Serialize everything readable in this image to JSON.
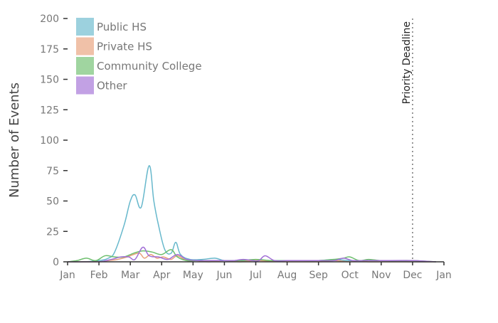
{
  "chart_data": {
    "type": "line",
    "title": "",
    "xlabel": "",
    "ylabel": "Number of Events",
    "ylim": [
      0,
      200
    ],
    "xlim": [
      1,
      13
    ],
    "x_ticks": [
      {
        "value": 1,
        "label": "Jan"
      },
      {
        "value": 2,
        "label": "Feb"
      },
      {
        "value": 3,
        "label": "Mar"
      },
      {
        "value": 4,
        "label": "Apr"
      },
      {
        "value": 5,
        "label": "May"
      },
      {
        "value": 6,
        "label": "Jun"
      },
      {
        "value": 7,
        "label": "Jul"
      },
      {
        "value": 8,
        "label": "Aug"
      },
      {
        "value": 9,
        "label": "Sep"
      },
      {
        "value": 10,
        "label": "Oct"
      },
      {
        "value": 11,
        "label": "Nov"
      },
      {
        "value": 12,
        "label": "Dec"
      },
      {
        "value": 13,
        "label": "Jan"
      }
    ],
    "y_ticks": [
      0,
      25,
      50,
      75,
      100,
      125,
      150,
      175,
      200
    ],
    "grid": false,
    "legend_position": "top-left",
    "x_unit": "month",
    "series": [
      {
        "name": "Public HS",
        "color": "#67B8CC",
        "x": [
          1,
          1.5,
          2.0,
          2.3,
          2.5,
          2.8,
          3.0,
          3.15,
          3.35,
          3.6,
          3.75,
          3.9,
          4.1,
          4.3,
          4.45,
          4.6,
          4.9,
          5.3,
          5.7,
          6.0,
          6.5,
          7.0,
          7.5,
          8.0,
          9.0,
          9.5,
          10.0,
          11.0,
          12.0,
          12.75
        ],
        "y": [
          0,
          0,
          1,
          3,
          8,
          30,
          50,
          55,
          45,
          79,
          50,
          30,
          10,
          7,
          16,
          6,
          2,
          2,
          3,
          1,
          1,
          1,
          1,
          1,
          1,
          2,
          1,
          1,
          0,
          0
        ]
      },
      {
        "name": "Private HS",
        "color": "#E8A07A",
        "x": [
          1,
          1.5,
          2.0,
          2.3,
          2.6,
          2.9,
          3.1,
          3.3,
          3.45,
          3.65,
          3.85,
          4.05,
          4.3,
          4.5,
          4.8,
          5.1,
          5.5,
          6.0,
          6.5,
          7.0,
          8.0,
          9.0,
          9.5,
          10.0,
          10.3,
          10.6,
          11.0,
          12.0,
          12.75
        ],
        "y": [
          0,
          0,
          0,
          1,
          2,
          4,
          6,
          7,
          3,
          6,
          3,
          4,
          2,
          5,
          1,
          1,
          0,
          1,
          0,
          1,
          0,
          0,
          1,
          0,
          1,
          0,
          0,
          0,
          0
        ]
      },
      {
        "name": "Community College",
        "color": "#6DBF6D",
        "x": [
          1,
          1.3,
          1.6,
          1.9,
          2.2,
          2.5,
          2.8,
          3.1,
          3.4,
          3.7,
          4.0,
          4.3,
          4.5,
          4.8,
          5.1,
          5.5,
          6.0,
          6.5,
          7.0,
          7.5,
          8.0,
          8.5,
          9.0,
          9.5,
          9.8,
          10.0,
          10.3,
          10.6,
          11.0,
          11.5,
          12.0,
          12.75
        ],
        "y": [
          0,
          1,
          3,
          1,
          5,
          4,
          4,
          7,
          9,
          8,
          6,
          10,
          4,
          1,
          1,
          1,
          1,
          1,
          2,
          1,
          1,
          1,
          1,
          2,
          3,
          4,
          1,
          2,
          1,
          1,
          1,
          0
        ]
      },
      {
        "name": "Other",
        "color": "#A16FD6",
        "x": [
          1,
          1.5,
          2.0,
          2.4,
          2.7,
          2.95,
          3.15,
          3.4,
          3.6,
          3.9,
          4.2,
          4.5,
          4.8,
          5.2,
          5.6,
          6.0,
          6.3,
          6.6,
          6.9,
          7.1,
          7.3,
          7.6,
          8.0,
          8.5,
          9.0,
          9.5,
          9.8,
          10.1,
          10.5,
          11.0,
          12.0,
          12.75
        ],
        "y": [
          0,
          0,
          0,
          2,
          4,
          4,
          2,
          12,
          5,
          4,
          2,
          6,
          2,
          1,
          1,
          1,
          1,
          2,
          1,
          1,
          5,
          1,
          1,
          1,
          1,
          1,
          3,
          1,
          1,
          1,
          1,
          0
        ]
      }
    ],
    "annotations": [
      {
        "x": 12,
        "label": "Priority Deadline",
        "style": "dotted-vertical-line"
      }
    ]
  }
}
